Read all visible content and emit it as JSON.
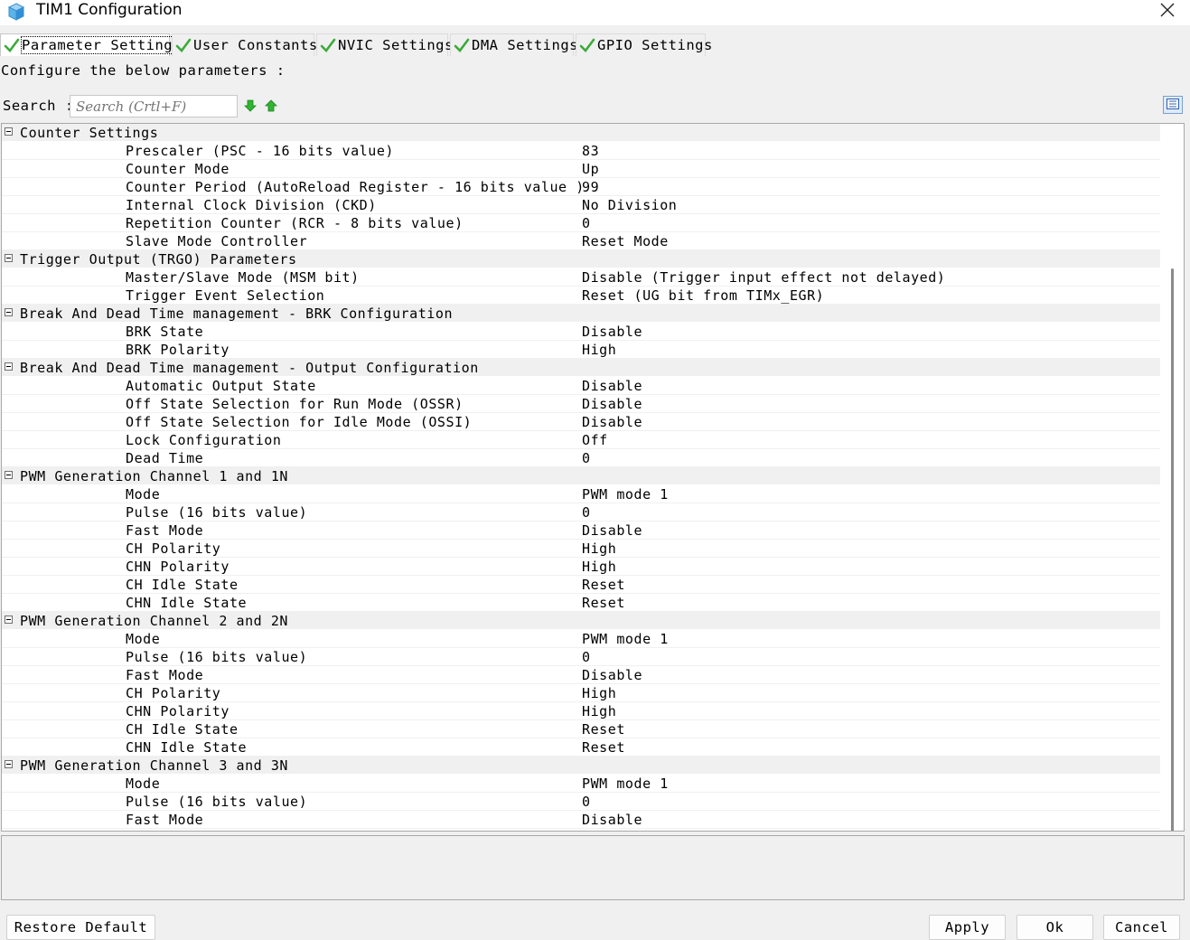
{
  "window": {
    "title": "TIM1 Configuration",
    "icon": "cube-icon",
    "close_icon": "close-icon"
  },
  "tabs": [
    {
      "label": "Parameter Settings",
      "active": true,
      "icon": "check-icon"
    },
    {
      "label": "User Constants",
      "active": false,
      "icon": "check-icon"
    },
    {
      "label": "NVIC Settings",
      "active": false,
      "icon": "check-icon"
    },
    {
      "label": "DMA Settings",
      "active": false,
      "icon": "check-icon"
    },
    {
      "label": "GPIO Settings",
      "active": false,
      "icon": "check-icon"
    }
  ],
  "description": "Configure the below parameters :",
  "search": {
    "label": "Search :",
    "placeholder": "Search (Crtl+F)"
  },
  "colors": {
    "check_green": "#3daa3a",
    "arrow_green": "#2fb52f",
    "group_bg": "#f0f0f0",
    "tree_bg": "#ffffff"
  },
  "parameters": [
    {
      "group": "Counter Settings",
      "items": [
        {
          "name": "Prescaler (PSC - 16 bits value)",
          "value": "83"
        },
        {
          "name": "Counter Mode",
          "value": "Up"
        },
        {
          "name": "Counter Period (AutoReload Register - 16 bits value )",
          "value": "99"
        },
        {
          "name": "Internal Clock Division (CKD)",
          "value": "No Division"
        },
        {
          "name": "Repetition Counter (RCR - 8 bits value)",
          "value": "0"
        },
        {
          "name": "Slave Mode Controller",
          "value": "Reset Mode"
        }
      ]
    },
    {
      "group": "Trigger Output (TRGO) Parameters",
      "items": [
        {
          "name": "Master/Slave Mode (MSM bit)",
          "value": "Disable (Trigger input effect not delayed)"
        },
        {
          "name": "Trigger Event Selection",
          "value": "Reset (UG bit from TIMx_EGR)"
        }
      ]
    },
    {
      "group": "Break And Dead Time management - BRK Configuration",
      "items": [
        {
          "name": "BRK State",
          "value": "Disable"
        },
        {
          "name": "BRK Polarity",
          "value": "High"
        }
      ]
    },
    {
      "group": "Break And Dead Time management - Output Configuration",
      "items": [
        {
          "name": "Automatic Output State",
          "value": "Disable"
        },
        {
          "name": "Off State Selection for Run Mode (OSSR)",
          "value": "Disable"
        },
        {
          "name": "Off State Selection for Idle Mode (OSSI)",
          "value": "Disable"
        },
        {
          "name": "Lock Configuration",
          "value": "Off"
        },
        {
          "name": "Dead Time",
          "value": "0"
        }
      ]
    },
    {
      "group": "PWM Generation Channel 1 and 1N",
      "items": [
        {
          "name": "Mode",
          "value": "PWM mode 1"
        },
        {
          "name": "Pulse (16 bits value)",
          "value": "0"
        },
        {
          "name": "Fast Mode",
          "value": "Disable"
        },
        {
          "name": "CH Polarity",
          "value": "High"
        },
        {
          "name": "CHN Polarity",
          "value": "High"
        },
        {
          "name": "CH Idle State",
          "value": "Reset"
        },
        {
          "name": "CHN Idle State",
          "value": "Reset"
        }
      ]
    },
    {
      "group": "PWM Generation Channel 2 and 2N",
      "items": [
        {
          "name": "Mode",
          "value": "PWM mode 1"
        },
        {
          "name": "Pulse (16 bits value)",
          "value": "0"
        },
        {
          "name": "Fast Mode",
          "value": "Disable"
        },
        {
          "name": "CH Polarity",
          "value": "High"
        },
        {
          "name": "CHN Polarity",
          "value": "High"
        },
        {
          "name": "CH Idle State",
          "value": "Reset"
        },
        {
          "name": "CHN Idle State",
          "value": "Reset"
        }
      ]
    },
    {
      "group": "PWM Generation Channel 3 and 3N",
      "items": [
        {
          "name": "Mode",
          "value": "PWM mode 1"
        },
        {
          "name": "Pulse (16 bits value)",
          "value": "0"
        },
        {
          "name": "Fast Mode",
          "value": "Disable"
        }
      ]
    }
  ],
  "buttons": {
    "restore": "Restore Default",
    "apply": "Apply",
    "ok": "Ok",
    "cancel": "Cancel"
  }
}
